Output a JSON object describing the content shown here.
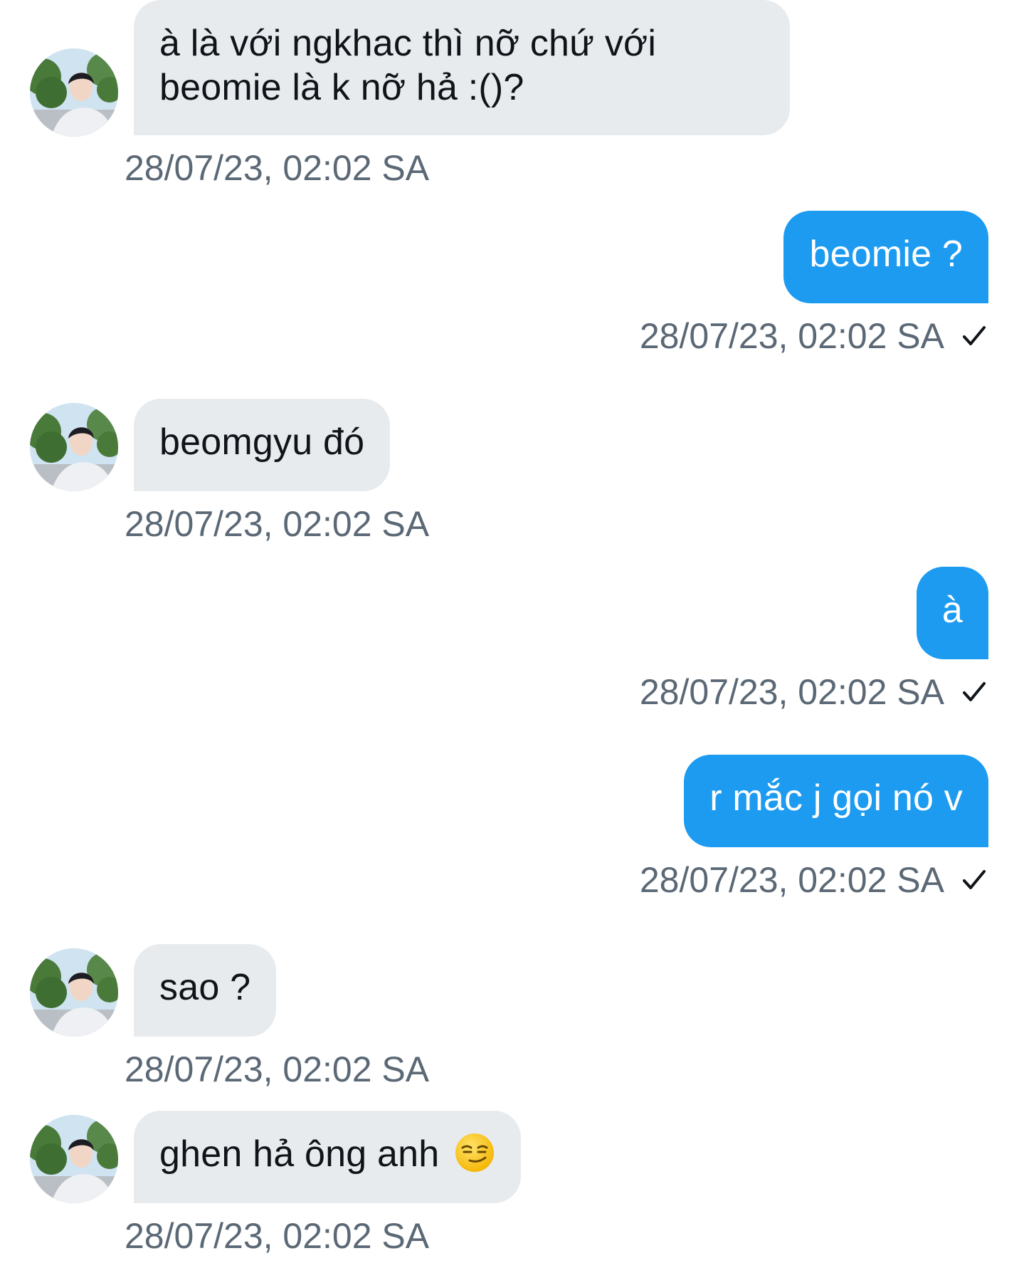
{
  "messages": [
    {
      "direction": "incoming",
      "text_line1": "à là với ngkhac thì nỡ chứ với",
      "text_line2": "beomie là k nỡ hả :()?",
      "timestamp": "28/07/23, 02:02 SA"
    },
    {
      "direction": "outgoing",
      "text": "beomie ?",
      "timestamp": "28/07/23, 02:02 SA",
      "status_icon": "check-icon"
    },
    {
      "direction": "incoming",
      "text": "beomgyu đó",
      "timestamp": "28/07/23, 02:02 SA"
    },
    {
      "direction": "outgoing",
      "text": "à",
      "timestamp": "28/07/23, 02:02 SA",
      "status_icon": "check-icon"
    },
    {
      "direction": "outgoing",
      "text": "r mắc j gọi nó v",
      "timestamp": "28/07/23, 02:02 SA",
      "status_icon": "check-icon"
    },
    {
      "direction": "incoming",
      "text": "sao ?",
      "timestamp": "28/07/23, 02:02 SA"
    },
    {
      "direction": "incoming",
      "text": "ghen hả ông anh",
      "emoji": "smirking-face",
      "timestamp": "28/07/23, 02:02 SA"
    }
  ],
  "colors": {
    "incoming_bubble": "#e8ebee",
    "outgoing_bubble": "#1d9bf0",
    "timestamp_text": "#5b6875",
    "incoming_text": "#0f1419",
    "outgoing_text": "#ffffff"
  }
}
